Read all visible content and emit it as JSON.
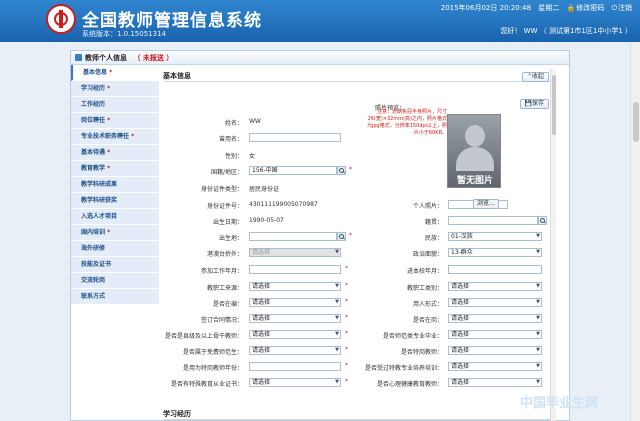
{
  "header": {
    "title": "全国教师管理信息系统",
    "version": "系统版本：1.0.15051314",
    "datetime": "2015年06月02日  20:20:48",
    "weekday": "星期二",
    "change_password": "修改密码",
    "logout": "注销",
    "user_info": "您好！ WW （ 测试第1市1区1中小学1 ）"
  },
  "panel": {
    "title": "教师个人信息",
    "status": "（ 未报送 ）"
  },
  "nav": {
    "items": [
      {
        "label": "基本信息",
        "required": "*"
      },
      {
        "label": "学习经历",
        "required": "*"
      },
      {
        "label": "工作经历",
        "required": ""
      },
      {
        "label": "岗位聘任",
        "required": "*"
      },
      {
        "label": "专业技术职务聘任",
        "required": "*"
      },
      {
        "label": "基本待遇",
        "required": "*"
      },
      {
        "label": "教育教学",
        "required": "*"
      },
      {
        "label": "教学科研成果",
        "required": ""
      },
      {
        "label": "教学科研获奖",
        "required": ""
      },
      {
        "label": "入选人才项目",
        "required": ""
      },
      {
        "label": "国内培训",
        "required": "*"
      },
      {
        "label": "海外研修",
        "required": ""
      },
      {
        "label": "技能及证书",
        "required": ""
      },
      {
        "label": "交流轮岗",
        "required": ""
      },
      {
        "label": "联系方式",
        "required": ""
      }
    ]
  },
  "main": {
    "section_title": "基本信息",
    "collapse_btn": "收起",
    "save_btn": "保存",
    "photo_label": "照片预览：",
    "photo_note": "注意：近期免冠半身照片，尺寸26(宽)×32mm(高)之内，照片格式为jpg格式，分辨率150dpi以上，照片小于60KB。",
    "photo_placeholder": "暂无图片",
    "personal_photo_label": "个人照片：",
    "browse_btn": "浏览...",
    "next_section": "学习经历"
  },
  "fields": {
    "name": {
      "label": "姓名：",
      "value": "WW"
    },
    "used_name": {
      "label": "曾用名：",
      "value": ""
    },
    "gender": {
      "label": "性别：",
      "value": "女"
    },
    "nationality": {
      "label": "国籍/地区：",
      "value": "156-中国"
    },
    "id_type": {
      "label": "身份证件类型：",
      "value": "居民身份证"
    },
    "id_number": {
      "label": "身份证件号：",
      "value": "430111199005070987"
    },
    "birth_date": {
      "label": "出生日期：",
      "value": "1990-05-07"
    },
    "native_place": {
      "label": "籍贯：",
      "value": ""
    },
    "birth_place": {
      "label": "出生地：",
      "value": ""
    },
    "ethnicity": {
      "label": "民族：",
      "value": "01-汉族"
    },
    "hk_macao_tw": {
      "label": "港澳台侨外：",
      "value": "请选择"
    },
    "political": {
      "label": "政治面貌：",
      "value": "13-群众"
    },
    "work_start": {
      "label": "参加工作年月：",
      "value": ""
    },
    "school_start": {
      "label": "进本校年月：",
      "value": ""
    },
    "staff_source": {
      "label": "教职工来源：",
      "value": "请选择"
    },
    "staff_category": {
      "label": "教职工类别：",
      "value": "请选择"
    },
    "on_staff": {
      "label": "是否在编：",
      "value": "请选择"
    },
    "employment": {
      "label": "用人形式：",
      "value": "请选择"
    },
    "contract": {
      "label": "签订合同情况：",
      "value": "请选择"
    },
    "on_duty": {
      "label": "是否在岗：",
      "value": "请选择"
    },
    "three_year_teach": {
      "label": "是否是县级及以上骨干教师：",
      "value": "请选择"
    },
    "teacher_graduate": {
      "label": "是否师范类专业毕业：",
      "value": "请选择"
    },
    "free_normal": {
      "label": "是否属于免费师范生：",
      "value": "请选择"
    },
    "special_post": {
      "label": "是否特岗教师：",
      "value": "请选择"
    },
    "special_start": {
      "label": "是用为特岗教师年份：",
      "value": ""
    },
    "special_training": {
      "label": "是否受过特教专业培养培训：",
      "value": "请选择"
    },
    "special_cert": {
      "label": "是否有特殊教育从业证书：",
      "value": "请选择"
    },
    "mental_health": {
      "label": "是否心理健康教育教师：",
      "value": "请选择"
    }
  },
  "watermark": "中国毕业生网"
}
